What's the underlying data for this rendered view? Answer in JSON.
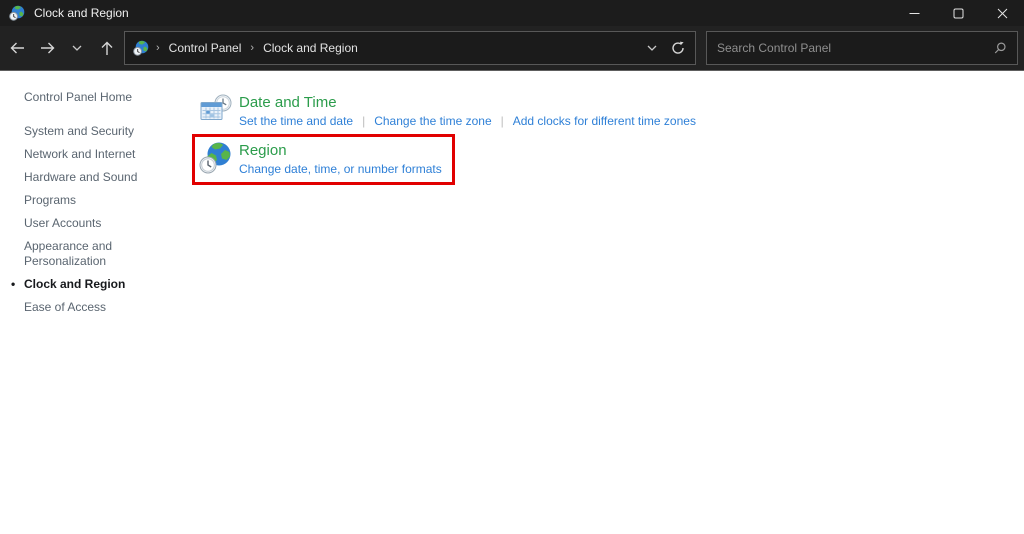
{
  "window": {
    "title": "Clock and Region"
  },
  "navbar": {
    "breadcrumb": {
      "items": [
        "Control Panel",
        "Clock and Region"
      ],
      "separator": "›"
    },
    "search": {
      "placeholder": "Search Control Panel"
    }
  },
  "sidebar": {
    "active_bullet": "•",
    "items": [
      {
        "label": "Control Panel Home",
        "home": true,
        "active": false
      },
      {
        "label": "System and Security",
        "home": false,
        "active": false
      },
      {
        "label": "Network and Internet",
        "home": false,
        "active": false
      },
      {
        "label": "Hardware and Sound",
        "home": false,
        "active": false
      },
      {
        "label": "Programs",
        "home": false,
        "active": false
      },
      {
        "label": "User Accounts",
        "home": false,
        "active": false
      },
      {
        "label": "Appearance and Personalization",
        "home": false,
        "active": false
      },
      {
        "label": "Clock and Region",
        "home": false,
        "active": true
      },
      {
        "label": "Ease of Access",
        "home": false,
        "active": false
      }
    ]
  },
  "main": {
    "link_separator": "|",
    "sections": [
      {
        "title": "Date and Time",
        "icon": "calendar-clock-icon",
        "links": [
          "Set the time and date",
          "Change the time zone",
          "Add clocks for different time zones"
        ],
        "highlighted": false
      },
      {
        "title": "Region",
        "icon": "globe-clock-icon",
        "links": [
          "Change date, time, or number formats"
        ],
        "highlighted": true
      }
    ]
  },
  "annotation": {
    "highlight_color": "#e10000",
    "target": "Region"
  },
  "colors": {
    "titlebar_bg": "#1c1c1c",
    "toolbar_bg": "#222222",
    "content_bg": "#ffffff",
    "section_title_green": "#2b9c4b",
    "task_link_blue": "#2f80d7",
    "sidebar_link": "#5a6570"
  }
}
